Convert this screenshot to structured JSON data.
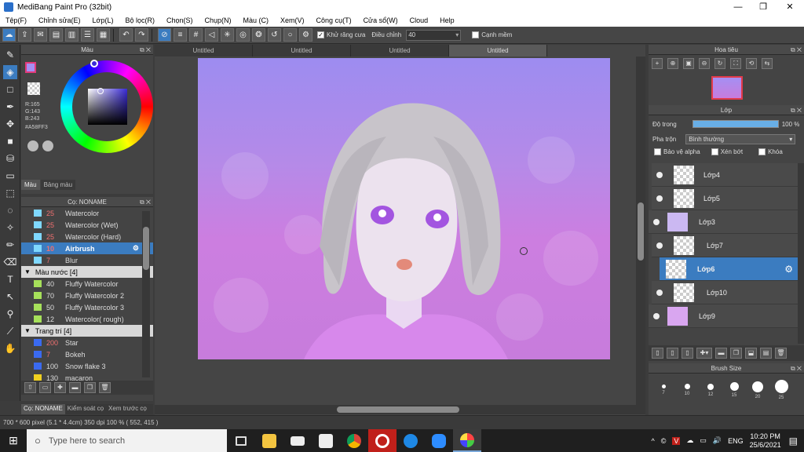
{
  "window": {
    "title": "MediBang Paint Pro (32bit)",
    "controls": {
      "minimize": "—",
      "maximize": "❐",
      "close": "✕"
    }
  },
  "menu": [
    "Tệp(F)",
    "Chỉnh sửa(E)",
    "Lớp(L)",
    "Bộ lọc(R)",
    "Chọn(S)",
    "Chụp(N)",
    "Màu (C)",
    "Xem(V)",
    "Công cụ(T)",
    "Cửa sổ(W)",
    "Cloud",
    "Help"
  ],
  "toolbar": {
    "antialias_label": "Khử răng cưa",
    "antialias_checked": true,
    "adjust_label": "Điều chỉnh",
    "adjust_value": "40",
    "smooth_edge_label": "Cạnh mềm",
    "smooth_edge_checked": false
  },
  "color_panel": {
    "title": "Màu",
    "r": "R:165",
    "g": "G:143",
    "b": "B:243",
    "hex": "#A58FF3",
    "fg_color": "#a58ff3",
    "tabs": [
      "Màu",
      "Bảng màu"
    ]
  },
  "brush_panel": {
    "title": "Cọ: NONAME",
    "items": [
      {
        "type": "brush",
        "num": "25",
        "name": "Watercolor",
        "color": "#7fd8ff",
        "red": true
      },
      {
        "type": "brush",
        "num": "25",
        "name": "Watercolor (Wet)",
        "color": "#7fd8ff",
        "red": true
      },
      {
        "type": "brush",
        "num": "25",
        "name": "Watercolor (Hard)",
        "color": "#7fd8ff",
        "red": true
      },
      {
        "type": "brush",
        "num": "10",
        "name": "Airbrush",
        "color": "#7fd8ff",
        "red": true,
        "selected": true
      },
      {
        "type": "brush",
        "num": "7",
        "name": "Blur",
        "color": "#7fd8ff",
        "red": true
      },
      {
        "type": "group",
        "name": "Màu nước [4]"
      },
      {
        "type": "brush",
        "num": "40",
        "name": "Fluffy Watercolor",
        "color": "#a6e05a",
        "red": false
      },
      {
        "type": "brush",
        "num": "70",
        "name": "Fluffy Watercolor 2",
        "color": "#a6e05a",
        "red": false
      },
      {
        "type": "brush",
        "num": "50",
        "name": "Fluffy Watercolor 3",
        "color": "#a6e05a",
        "red": false
      },
      {
        "type": "brush",
        "num": "12",
        "name": "Watercolor( rough)",
        "color": "#a6e05a",
        "red": false
      },
      {
        "type": "group",
        "name": "Trang trí [4]"
      },
      {
        "type": "brush",
        "num": "200",
        "name": "Star",
        "color": "#3a6af0",
        "red": true
      },
      {
        "type": "brush",
        "num": "7",
        "name": "Bokeh",
        "color": "#3a6af0",
        "red": true
      },
      {
        "type": "brush",
        "num": "100",
        "name": "Snow flake 3",
        "color": "#3a6af0",
        "red": false
      },
      {
        "type": "brush",
        "num": "130",
        "name": "macaron",
        "color": "#f0d020",
        "red": false
      }
    ],
    "bottom_tabs": [
      "Cọ: NONAME",
      "Kiểm soát cọ",
      "Xem trước cọ"
    ]
  },
  "canvas": {
    "tabs": [
      "Untitled",
      "Untitled",
      "Untitled",
      "Untitled"
    ],
    "active_tab": 3
  },
  "navigator": {
    "title": "Hoa tiêu"
  },
  "layer_panel": {
    "title": "Lớp",
    "opacity_label": "Độ trong",
    "opacity_value": "100 %",
    "blend_label": "Pha trộn",
    "blend_value": "Bình thường",
    "protect_alpha": "Bảo vệ alpha",
    "clipping": "Xén bớt",
    "lock": "Khóa",
    "layers": [
      "Lớp4",
      "Lớp5",
      "Lớp3",
      "Lớp7",
      "Lớp6",
      "Lớp10",
      "Lớp9"
    ],
    "selected": "Lớp6"
  },
  "brush_size": {
    "title": "Brush Size",
    "sizes": [
      "7",
      "10",
      "12",
      "15",
      "20",
      "25"
    ]
  },
  "status": {
    "text": "700 * 600 pixel   (5.1 * 4.4cm)   350 dpi   100 %   ( 552, 415 )"
  },
  "taskbar": {
    "search_placeholder": "Type here to search",
    "lang": "ENG",
    "time": "10:20 PM",
    "date": "25/6/2021"
  }
}
